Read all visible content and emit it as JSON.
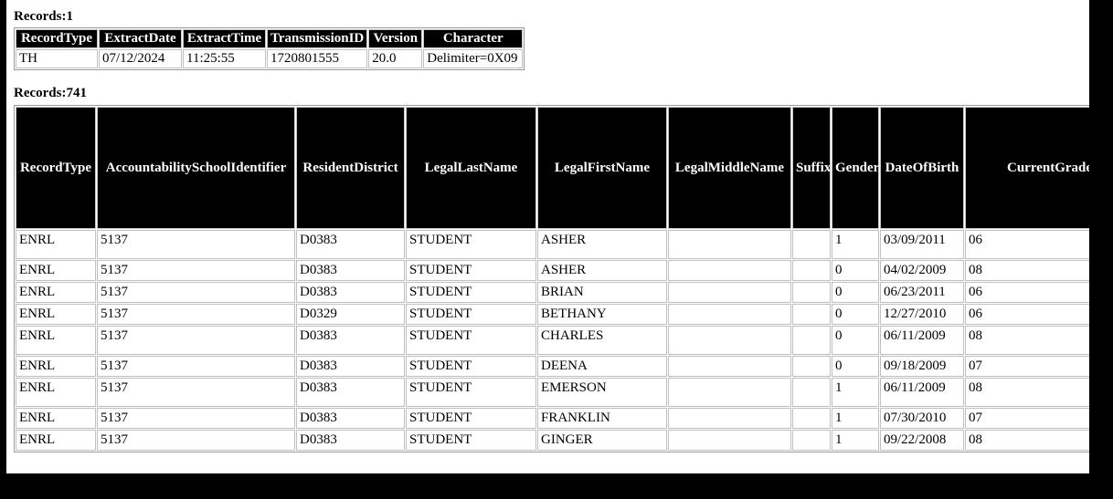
{
  "page": {
    "header_section": {
      "records_label": "Records:1",
      "columns": [
        "RecordType",
        "ExtractDate",
        "ExtractTime",
        "TransmissionID",
        "Version",
        "Character"
      ],
      "rows": [
        {
          "RecordType": "TH",
          "ExtractDate": "07/12/2024",
          "ExtractTime": "11:25:55",
          "TransmissionID": "1720801555",
          "Version": "20.0",
          "Character": "Delimiter=0X09"
        }
      ]
    },
    "detail_section": {
      "records_label": "Records:741",
      "columns": [
        "RecordType",
        "AccountabilitySchoolIdentifier",
        "ResidentDistrict",
        "LegalLastName",
        "LegalFirstName",
        "LegalMiddleName",
        "Suffix",
        "Gender",
        "DateOfBirth",
        "CurrentGradeLevel"
      ],
      "rows": [
        {
          "RecordType": "ENRL",
          "AccountabilitySchoolIdentifier": "5137",
          "ResidentDistrict": "D0383",
          "LegalLastName": "STUDENT",
          "LegalFirstName": "ASHER",
          "LegalMiddleName": "",
          "Suffix": "",
          "Gender": "1",
          "DateOfBirth": "03/09/2011",
          "CurrentGradeLevel": "06",
          "tall": true
        },
        {
          "RecordType": "ENRL",
          "AccountabilitySchoolIdentifier": "5137",
          "ResidentDistrict": "D0383",
          "LegalLastName": "STUDENT",
          "LegalFirstName": "ASHER",
          "LegalMiddleName": "",
          "Suffix": "",
          "Gender": "0",
          "DateOfBirth": "04/02/2009",
          "CurrentGradeLevel": "08",
          "tall": false
        },
        {
          "RecordType": "ENRL",
          "AccountabilitySchoolIdentifier": "5137",
          "ResidentDistrict": "D0383",
          "LegalLastName": "STUDENT",
          "LegalFirstName": "BRIAN",
          "LegalMiddleName": "",
          "Suffix": "",
          "Gender": "0",
          "DateOfBirth": "06/23/2011",
          "CurrentGradeLevel": "06",
          "tall": false
        },
        {
          "RecordType": "ENRL",
          "AccountabilitySchoolIdentifier": "5137",
          "ResidentDistrict": "D0329",
          "LegalLastName": "STUDENT",
          "LegalFirstName": "BETHANY",
          "LegalMiddleName": "",
          "Suffix": "",
          "Gender": "0",
          "DateOfBirth": "12/27/2010",
          "CurrentGradeLevel": "06",
          "tall": false
        },
        {
          "RecordType": "ENRL",
          "AccountabilitySchoolIdentifier": "5137",
          "ResidentDistrict": "D0383",
          "LegalLastName": "STUDENT",
          "LegalFirstName": "CHARLES",
          "LegalMiddleName": "",
          "Suffix": "",
          "Gender": "0",
          "DateOfBirth": "06/11/2009",
          "CurrentGradeLevel": "08",
          "tall": true
        },
        {
          "RecordType": "ENRL",
          "AccountabilitySchoolIdentifier": "5137",
          "ResidentDistrict": "D0383",
          "LegalLastName": "STUDENT",
          "LegalFirstName": "DEENA",
          "LegalMiddleName": "",
          "Suffix": "",
          "Gender": "0",
          "DateOfBirth": "09/18/2009",
          "CurrentGradeLevel": "07",
          "tall": false
        },
        {
          "RecordType": "ENRL",
          "AccountabilitySchoolIdentifier": "5137",
          "ResidentDistrict": "D0383",
          "LegalLastName": "STUDENT",
          "LegalFirstName": "EMERSON",
          "LegalMiddleName": "",
          "Suffix": "",
          "Gender": "1",
          "DateOfBirth": "06/11/2009",
          "CurrentGradeLevel": "08",
          "tall": true
        },
        {
          "RecordType": "ENRL",
          "AccountabilitySchoolIdentifier": "5137",
          "ResidentDistrict": "D0383",
          "LegalLastName": "STUDENT",
          "LegalFirstName": "FRANKLIN",
          "LegalMiddleName": "",
          "Suffix": "",
          "Gender": "1",
          "DateOfBirth": "07/30/2010",
          "CurrentGradeLevel": "07",
          "tall": false
        },
        {
          "RecordType": "ENRL",
          "AccountabilitySchoolIdentifier": "5137",
          "ResidentDistrict": "D0383",
          "LegalLastName": "STUDENT",
          "LegalFirstName": "GINGER",
          "LegalMiddleName": "",
          "Suffix": "",
          "Gender": "1",
          "DateOfBirth": "09/22/2008",
          "CurrentGradeLevel": "08",
          "tall": false
        }
      ]
    }
  },
  "colors": {
    "header_background": "#000000",
    "header_text": "#ffffff",
    "cell_background": "#ffffff",
    "cell_text": "#000000",
    "page_background": "#ffffff",
    "frame": "#000000",
    "grid_line": "#c0c0c0"
  },
  "layout": {
    "header_table_col_widths": [
      90,
      91,
      91,
      107,
      59,
      109
    ],
    "detail_table_col_widths": [
      88,
      217,
      119,
      143,
      142,
      135,
      42,
      52,
      92,
      220
    ]
  }
}
